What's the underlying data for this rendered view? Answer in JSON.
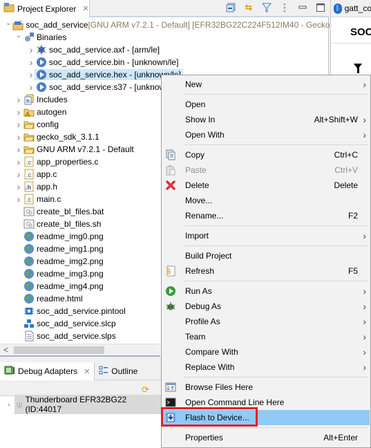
{
  "project_explorer": {
    "tab_label": "Project Explorer",
    "toolbar_icons": [
      "collapse-all-icon",
      "link-with-editor-icon",
      "filter-icon",
      "view-menu-icon",
      "minimize-icon",
      "maximize-icon"
    ],
    "tree": [
      {
        "label": "soc_add_service",
        "suffix": " [GNU ARM v7.2.1 - Default] [EFR32BG22C224F512IM40 - Gecko",
        "icon": "project-icon",
        "arrow": "expanded",
        "indent": 0
      },
      {
        "label": "Binaries",
        "icon": "binaries-icon",
        "arrow": "expanded",
        "indent": 1
      },
      {
        "label": "soc_add_service.axf - [arm/le]",
        "icon": "bug-binary-icon",
        "arrow": "collapsed",
        "indent": 2
      },
      {
        "label": "soc_add_service.bin - [unknown/le]",
        "icon": "binary-play-icon",
        "arrow": "collapsed",
        "indent": 2
      },
      {
        "label": "soc_add_service.hex - [unknown/le]",
        "icon": "binary-play-icon",
        "arrow": "collapsed",
        "indent": 2,
        "selected": true
      },
      {
        "label": "soc_add_service.s37 - [unknown/le]",
        "icon": "binary-play-icon",
        "arrow": "collapsed",
        "indent": 2
      },
      {
        "label": "Includes",
        "icon": "includes-icon",
        "arrow": "collapsed",
        "indent": 1
      },
      {
        "label": "autogen",
        "icon": "folder-warning-icon",
        "arrow": "collapsed",
        "indent": 1
      },
      {
        "label": "config",
        "icon": "folder-icon",
        "arrow": "collapsed",
        "indent": 1
      },
      {
        "label": "gecko_sdk_3.1.1",
        "icon": "folder-icon",
        "arrow": "collapsed",
        "indent": 1
      },
      {
        "label": "GNU ARM v7.2.1 - Default",
        "icon": "folder-icon",
        "arrow": "collapsed",
        "indent": 1
      },
      {
        "label": "app_properties.c",
        "icon": "c-file-icon",
        "arrow": "collapsed",
        "indent": 1
      },
      {
        "label": "app.c",
        "icon": "c-file-icon",
        "arrow": "collapsed",
        "indent": 1
      },
      {
        "label": "app.h",
        "icon": "h-file-icon",
        "arrow": "collapsed",
        "indent": 1
      },
      {
        "label": "main.c",
        "icon": "c-file-icon",
        "arrow": "collapsed",
        "indent": 1
      },
      {
        "label": "create_bl_files.bat",
        "icon": "script-file-icon",
        "arrow": "none",
        "indent": 1
      },
      {
        "label": "create_bl_files.sh",
        "icon": "script-file-icon",
        "arrow": "none",
        "indent": 1
      },
      {
        "label": "readme_img0.png",
        "icon": "globe-icon",
        "arrow": "none",
        "indent": 1
      },
      {
        "label": "readme_img1.png",
        "icon": "globe-icon",
        "arrow": "none",
        "indent": 1
      },
      {
        "label": "readme_img2.png",
        "icon": "globe-icon",
        "arrow": "none",
        "indent": 1
      },
      {
        "label": "readme_img3.png",
        "icon": "globe-icon",
        "arrow": "none",
        "indent": 1
      },
      {
        "label": "readme_img4.png",
        "icon": "globe-icon",
        "arrow": "none",
        "indent": 1
      },
      {
        "label": "readme.html",
        "icon": "globe-icon",
        "arrow": "none",
        "indent": 1
      },
      {
        "label": "soc_add_service.pintool",
        "icon": "pintool-icon",
        "arrow": "none",
        "indent": 1
      },
      {
        "label": "soc_add_service.slcp",
        "icon": "slcp-icon",
        "arrow": "none",
        "indent": 1
      },
      {
        "label": "soc_add_service.slps",
        "icon": "text-file-icon",
        "arrow": "none",
        "indent": 1
      }
    ]
  },
  "right_editor": {
    "tab_label": "gatt_co",
    "title": "SOC",
    "filter_label": "F"
  },
  "debug_adapters": {
    "tabs": [
      {
        "label": "Debug Adapters",
        "icon": "debug-adapter-icon",
        "active": true
      },
      {
        "label": "Outline",
        "icon": "outline-icon",
        "active": false
      }
    ],
    "device": "Thunderboard EFR32BG22 (ID:44017"
  },
  "context_menu": {
    "items": [
      {
        "label": "New",
        "submenu": true
      },
      {
        "sep": true
      },
      {
        "label": "Open"
      },
      {
        "label": "Show In",
        "shortcut": "Alt+Shift+W",
        "submenu": true
      },
      {
        "label": "Open With",
        "submenu": true
      },
      {
        "sep": true
      },
      {
        "label": "Copy",
        "shortcut": "Ctrl+C",
        "icon": "copy-icon"
      },
      {
        "label": "Paste",
        "shortcut": "Ctrl+V",
        "icon": "paste-icon",
        "disabled": true
      },
      {
        "label": "Delete",
        "shortcut": "Delete",
        "icon": "delete-icon"
      },
      {
        "label": "Move..."
      },
      {
        "label": "Rename...",
        "shortcut": "F2"
      },
      {
        "sep": true
      },
      {
        "label": "Import",
        "submenu": true
      },
      {
        "sep": true
      },
      {
        "label": "Build Project"
      },
      {
        "label": "Refresh",
        "shortcut": "F5",
        "icon": "refresh-icon"
      },
      {
        "sep": true
      },
      {
        "label": "Run As",
        "submenu": true,
        "icon": "run-icon"
      },
      {
        "label": "Debug As",
        "submenu": true,
        "icon": "debug-icon"
      },
      {
        "label": "Profile As",
        "submenu": true
      },
      {
        "label": "Team",
        "submenu": true
      },
      {
        "label": "Compare With",
        "submenu": true
      },
      {
        "label": "Replace With",
        "submenu": true
      },
      {
        "sep": true
      },
      {
        "label": "Browse Files Here",
        "icon": "browse-files-icon"
      },
      {
        "label": "Open Command Line Here",
        "icon": "terminal-icon"
      },
      {
        "label": "Flash to Device...",
        "icon": "flash-device-icon",
        "highlighted": true
      },
      {
        "sep": true
      },
      {
        "label": "Properties",
        "shortcut": "Alt+Enter"
      }
    ],
    "highlight_color": "#91c9f7",
    "annotation_color": "#e2202a"
  }
}
